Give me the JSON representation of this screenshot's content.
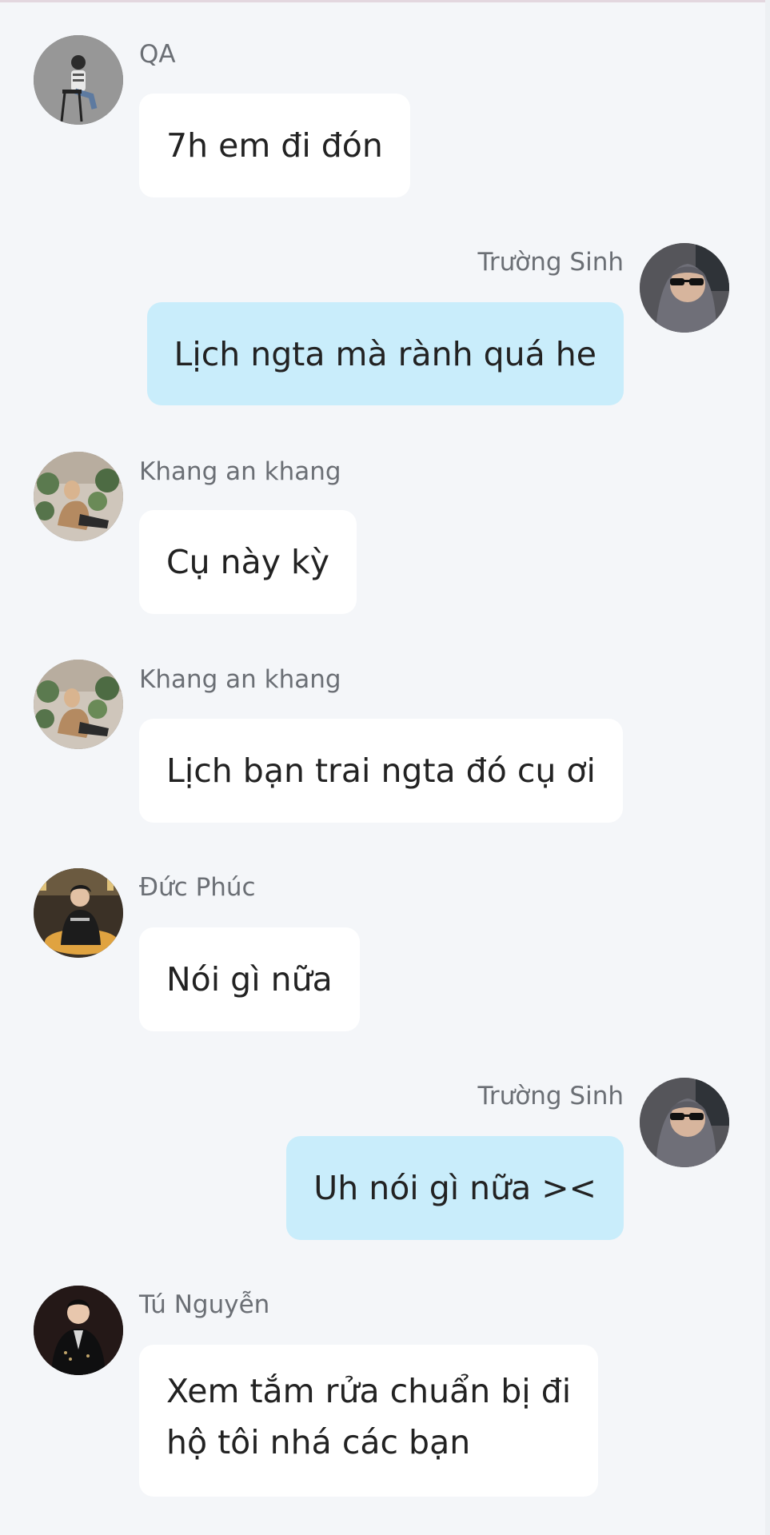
{
  "messages": [
    {
      "sender": "QA",
      "text": "7h em đi đón",
      "direction": "incoming",
      "avatar_icon": "person-sitting-on-chair-avatar"
    },
    {
      "sender": "Trường Sinh",
      "text": "Lịch ngta mà rành quá he",
      "direction": "outgoing",
      "avatar_icon": "person-hoodie-sunglasses-avatar"
    },
    {
      "sender": "Khang an khang",
      "text": "Cụ này kỳ",
      "direction": "incoming",
      "avatar_icon": "person-with-plants-avatar"
    },
    {
      "sender": "Khang an khang",
      "text": "Lịch bạn trai ngta đó cụ ơi",
      "direction": "incoming",
      "avatar_icon": "person-with-plants-avatar"
    },
    {
      "sender": "Đức Phúc",
      "text": "Nói gì nữa",
      "direction": "incoming",
      "avatar_icon": "person-dark-shirt-avatar"
    },
    {
      "sender": "Trường Sinh",
      "text": "Uh nói gì nữa ><",
      "direction": "outgoing",
      "avatar_icon": "person-hoodie-sunglasses-avatar"
    },
    {
      "sender": "Tú Nguyễn",
      "text_lines": [
        "Xem tắm rửa chuẩn bị đi",
        "hộ tôi nhá các bạn"
      ],
      "direction": "incoming",
      "avatar_icon": "person-black-suit-avatar"
    }
  ],
  "colors": {
    "background": "#f4f6f9",
    "incoming_bubble": "#ffffff",
    "outgoing_bubble": "#c9edfb",
    "sender_text": "#6b6f75",
    "message_text": "#222222"
  }
}
